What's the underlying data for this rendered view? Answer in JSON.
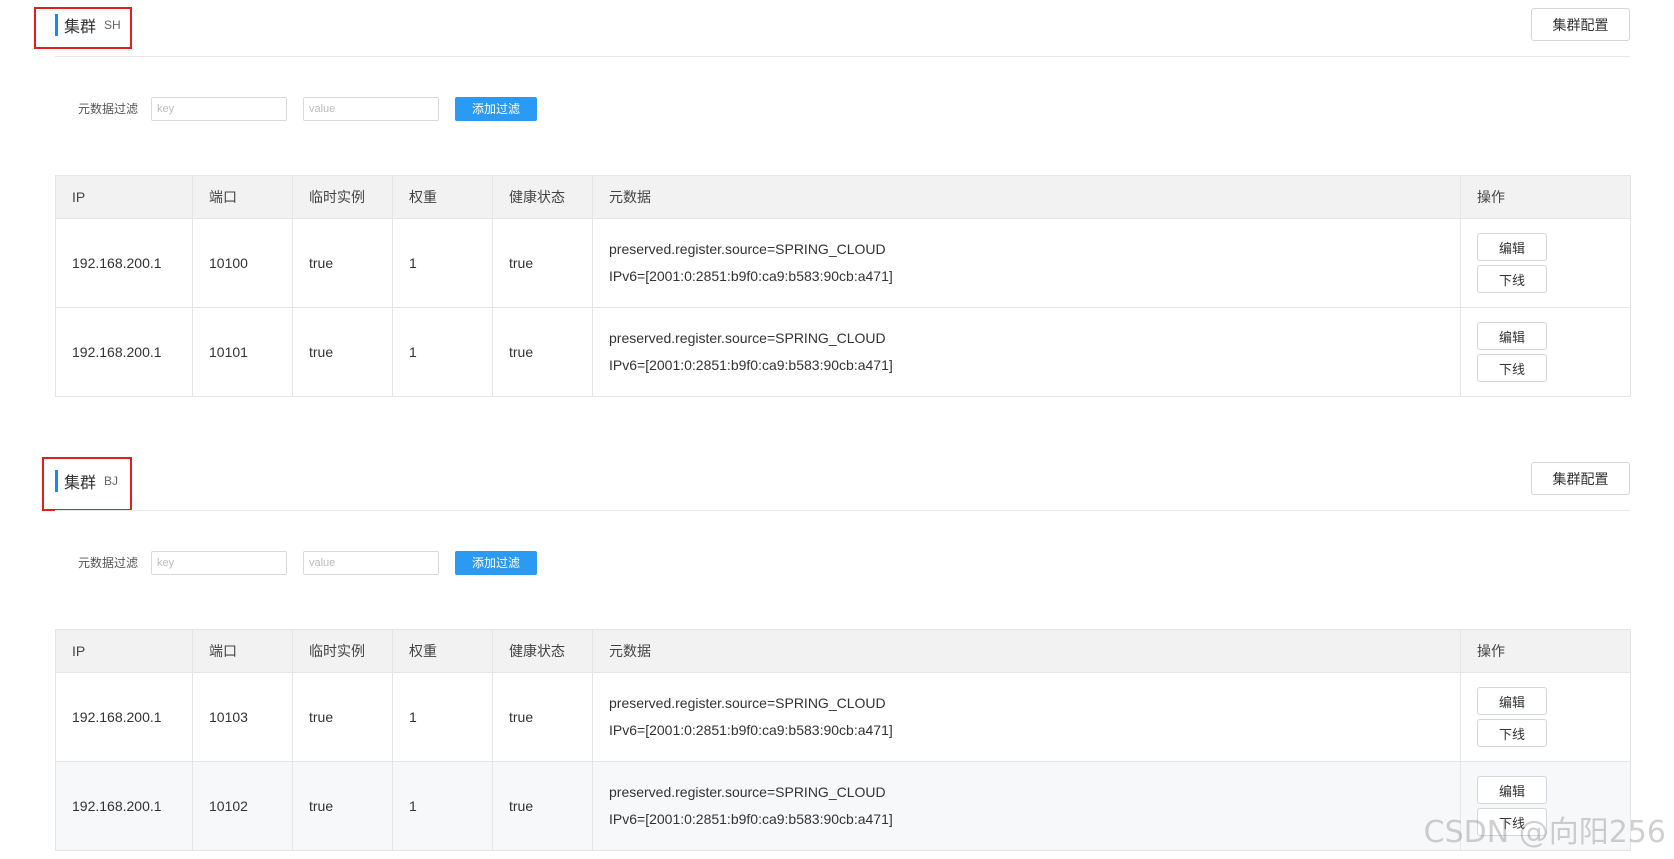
{
  "clusters": [
    {
      "title": "集群",
      "name": "SH",
      "config_button": "集群配置",
      "filter": {
        "label": "元数据过滤",
        "key_placeholder": "key",
        "value_placeholder": "value",
        "add_button": "添加过滤"
      },
      "columns": [
        "IP",
        "端口",
        "临时实例",
        "权重",
        "健康状态",
        "元数据",
        "操作"
      ],
      "rows": [
        {
          "ip": "192.168.200.1",
          "port": "10100",
          "ephemeral": "true",
          "weight": "1",
          "healthy": "true",
          "meta1": "preserved.register.source=SPRING_CLOUD",
          "meta2": "IPv6=[2001:0:2851:b9f0:ca9:b583:90cb:a471]",
          "edit": "编辑",
          "offline": "下线"
        },
        {
          "ip": "192.168.200.1",
          "port": "10101",
          "ephemeral": "true",
          "weight": "1",
          "healthy": "true",
          "meta1": "preserved.register.source=SPRING_CLOUD",
          "meta2": "IPv6=[2001:0:2851:b9f0:ca9:b583:90cb:a471]",
          "edit": "编辑",
          "offline": "下线"
        }
      ]
    },
    {
      "title": "集群",
      "name": "BJ",
      "config_button": "集群配置",
      "filter": {
        "label": "元数据过滤",
        "key_placeholder": "key",
        "value_placeholder": "value",
        "add_button": "添加过滤"
      },
      "columns": [
        "IP",
        "端口",
        "临时实例",
        "权重",
        "健康状态",
        "元数据",
        "操作"
      ],
      "rows": [
        {
          "ip": "192.168.200.1",
          "port": "10103",
          "ephemeral": "true",
          "weight": "1",
          "healthy": "true",
          "meta1": "preserved.register.source=SPRING_CLOUD",
          "meta2": "IPv6=[2001:0:2851:b9f0:ca9:b583:90cb:a471]",
          "edit": "编辑",
          "offline": "下线"
        },
        {
          "ip": "192.168.200.1",
          "port": "10102",
          "ephemeral": "true",
          "weight": "1",
          "healthy": "true",
          "meta1": "preserved.register.source=SPRING_CLOUD",
          "meta2": "IPv6=[2001:0:2851:b9f0:ca9:b583:90cb:a471]",
          "edit": "编辑",
          "offline": "下线"
        }
      ]
    }
  ],
  "watermark": "CSDN @向阳256",
  "colors": {
    "accent": "#1e87f0",
    "primary_button": "#2b9af3",
    "highlight_box": "#e02020"
  }
}
